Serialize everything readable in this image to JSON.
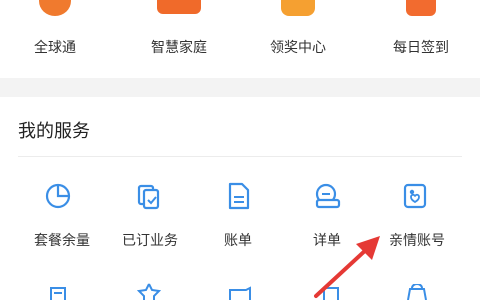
{
  "top_row": [
    {
      "label": "全球通",
      "icon": "globe-pass-icon",
      "color": "#f07a2e"
    },
    {
      "label": "智慧家庭",
      "icon": "smart-home-icon",
      "color": "#f06a2a"
    },
    {
      "label": "领奖中心",
      "icon": "prize-center-icon",
      "color": "#f5a031"
    },
    {
      "label": "每日签到",
      "icon": "daily-checkin-icon",
      "color": "#f26b2f"
    }
  ],
  "services": {
    "title": "我的服务",
    "items": [
      {
        "label": "套餐余量",
        "icon": "pie-chart-icon"
      },
      {
        "label": "已订业务",
        "icon": "subscribed-service-icon"
      },
      {
        "label": "账单",
        "icon": "bill-document-icon"
      },
      {
        "label": "详单",
        "icon": "detail-list-icon"
      },
      {
        "label": "亲情账号",
        "icon": "family-account-icon"
      }
    ],
    "icon_color": "#3a8ee6"
  },
  "annotation": {
    "type": "red-arrow",
    "color": "#e53935"
  }
}
